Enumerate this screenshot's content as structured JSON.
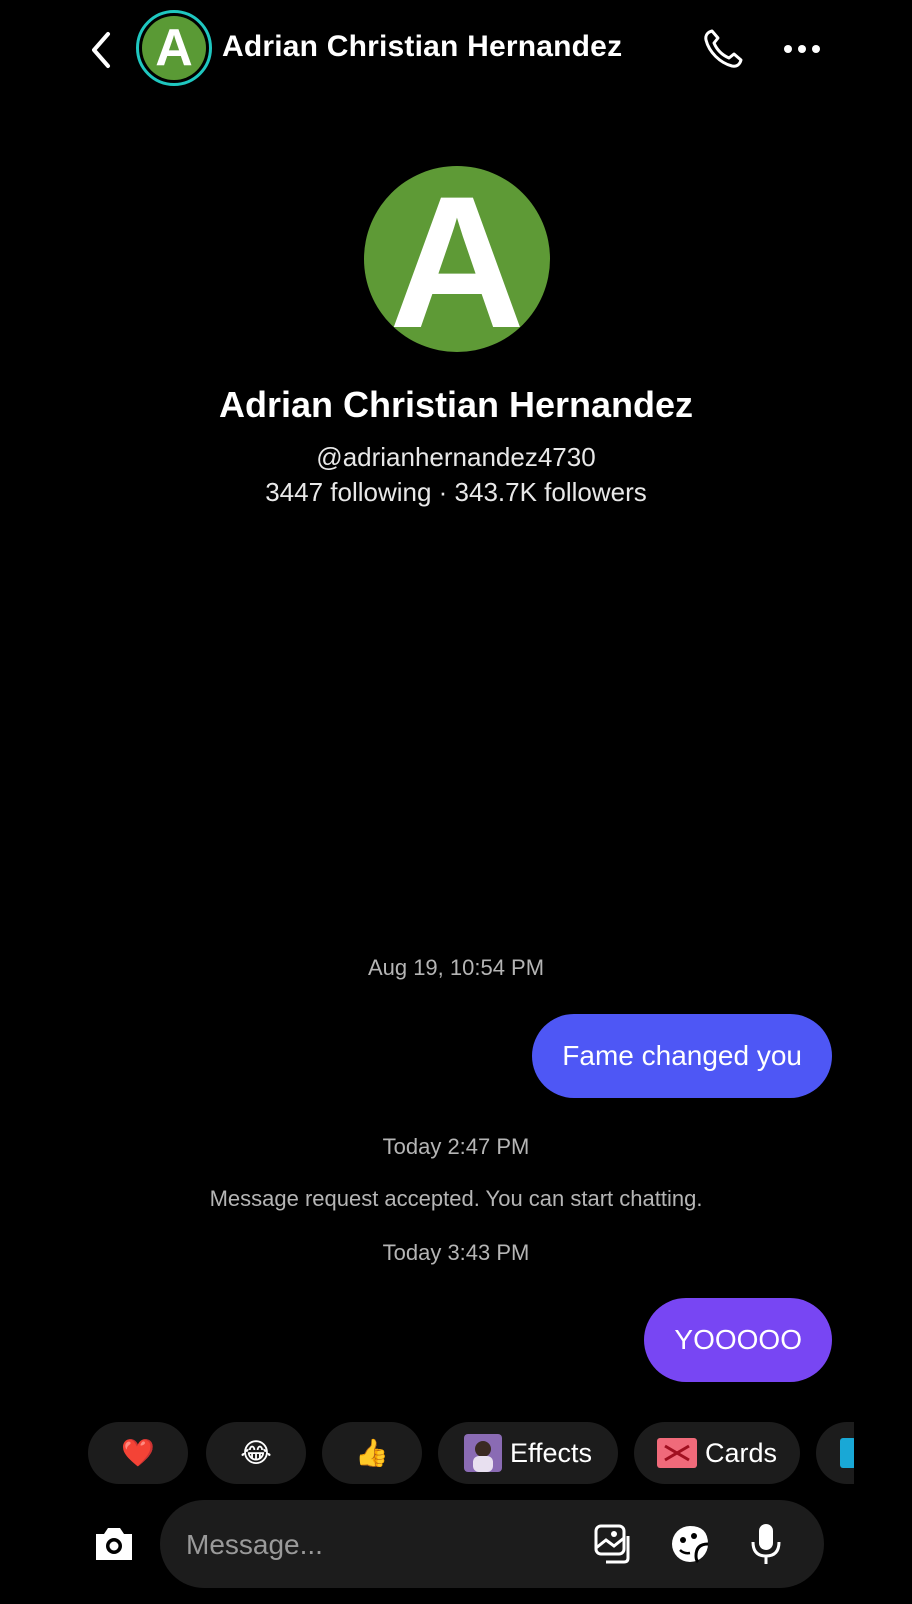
{
  "header": {
    "name": "Adrian Christian Hernandez",
    "avatar_letter": "A"
  },
  "profile": {
    "avatar_letter": "A",
    "name": "Adrian Christian Hernandez",
    "handle": "@adrianhernandez4730",
    "stats": "3447 following · 343.7K followers"
  },
  "messages": {
    "time1": "Aug 19, 10:54 PM",
    "msg1": "Fame changed you",
    "time2": "Today 2:47 PM",
    "system": "Message request accepted. You can start chatting.",
    "time3": "Today 3:43 PM",
    "msg2": "YOOOOO"
  },
  "quick_replies": {
    "heart": "❤️",
    "laugh": "😂",
    "thumbs": "👍",
    "effects": "Effects",
    "cards": "Cards"
  },
  "composer": {
    "placeholder": "Message..."
  },
  "colors": {
    "accent_blue": "#4e57f5",
    "accent_purple": "#7846f3",
    "avatar_green": "#5e9a36"
  }
}
